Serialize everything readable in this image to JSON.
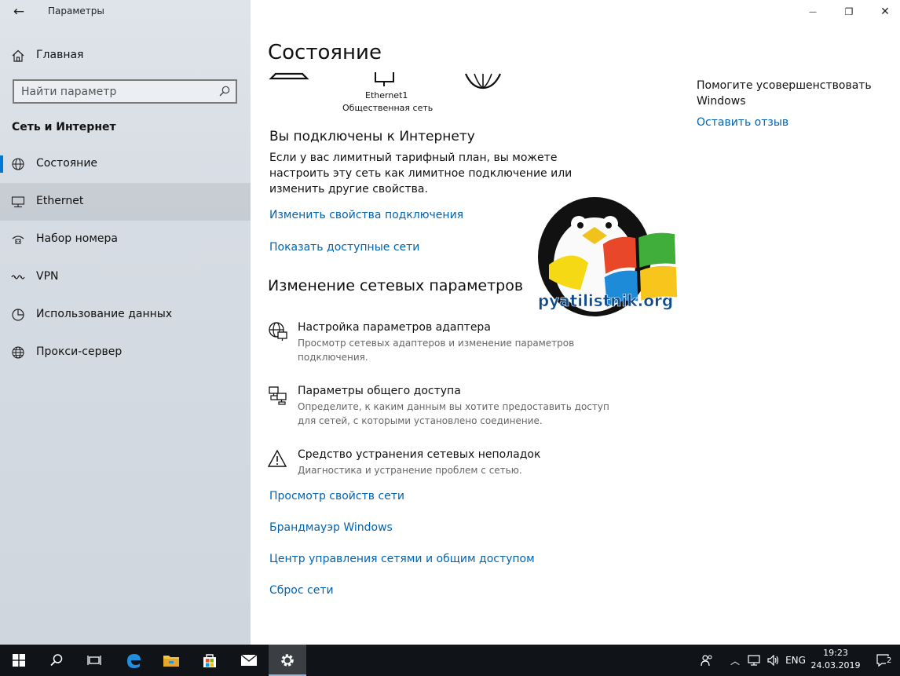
{
  "window": {
    "title": "Параметры",
    "controls": {
      "minimize": "—",
      "restore": "❐",
      "close": "✕"
    }
  },
  "sidebar": {
    "back_icon": "back-arrow-icon",
    "home_label": "Главная",
    "search_placeholder": "Найти параметр",
    "section_heading": "Сеть и Интернет",
    "items": [
      {
        "label": "Состояние",
        "icon": "globe-status-icon",
        "active": true
      },
      {
        "label": "Ethernet",
        "icon": "ethernet-icon",
        "hover": true
      },
      {
        "label": "Набор номера",
        "icon": "dialup-icon"
      },
      {
        "label": "VPN",
        "icon": "vpn-icon"
      },
      {
        "label": "Использование данных",
        "icon": "data-usage-icon"
      },
      {
        "label": "Прокси-сервер",
        "icon": "globe-icon"
      }
    ]
  },
  "main": {
    "title": "Состояние",
    "network_name": "Ethernet1",
    "network_type": "Общественная сеть",
    "connected_heading": "Вы подключены к Интернету",
    "connected_text": "Если у вас лимитный тарифный план, вы можете настроить эту сеть как лимитное подключение или изменить другие свойства.",
    "link_change_props": "Изменить свойства подключения",
    "link_show_networks": "Показать доступные сети",
    "change_heading": "Изменение сетевых параметров",
    "options": [
      {
        "title": "Настройка параметров адаптера",
        "desc": "Просмотр сетевых адаптеров и изменение параметров подключения.",
        "icon": "adapter-settings-icon"
      },
      {
        "title": "Параметры общего доступа",
        "desc": "Определите, к каким данным вы хотите предоставить доступ для сетей, с которыми установлено соединение.",
        "icon": "sharing-icon"
      },
      {
        "title": "Средство устранения сетевых неполадок",
        "desc": "Диагностика и устранение проблем с сетью.",
        "icon": "warning-icon"
      }
    ],
    "links": [
      "Просмотр свойств сети",
      "Брандмауэр Windows",
      "Центр управления сетями и общим доступом",
      "Сброс сети"
    ]
  },
  "help": {
    "title": "Помогите усовершенствовать Windows",
    "link": "Оставить отзыв"
  },
  "watermark": {
    "text": "pyatilistnik.org"
  },
  "taskbar": {
    "language": "ENG",
    "time": "19:23",
    "date": "24.03.2019",
    "notifications_count": "2"
  },
  "colors": {
    "accent": "#0078d7",
    "link": "#0063b1",
    "taskbar": "#101418"
  }
}
